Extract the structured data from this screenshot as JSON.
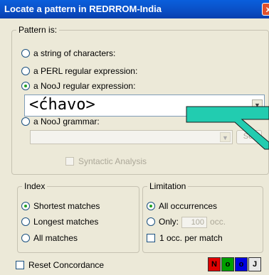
{
  "window": {
    "title": "Locate a pattern in REDRROM-India",
    "close_glyph": "x"
  },
  "pattern": {
    "legend": "Pattern is:",
    "options": [
      {
        "label": "a string of characters:",
        "selected": false
      },
      {
        "label": "a PERL regular expression:",
        "selected": false
      },
      {
        "label": "a NooJ regular expression:",
        "selected": true
      },
      {
        "label": "a NooJ grammar:",
        "selected": false
      }
    ],
    "regex_value": "<ćhavo>",
    "set_button": "Set",
    "syntactic_analysis": "Syntactic Analysis",
    "combo_arrow": "▼"
  },
  "index": {
    "legend": "Index",
    "options": [
      {
        "label": "Shortest matches",
        "selected": true
      },
      {
        "label": "Longest matches",
        "selected": false
      },
      {
        "label": "All matches",
        "selected": false
      }
    ]
  },
  "limitation": {
    "legend": "Limitation",
    "all_occurrences": "All occurrences",
    "only_label": "Only:",
    "only_value": "100",
    "occ_label": "occ.",
    "per_match": "1 occ. per match"
  },
  "footer": {
    "reset_concordance": "Reset Concordance",
    "color_buttons": [
      {
        "label": "N",
        "bg": "#e00000",
        "fg": "#000000"
      },
      {
        "label": "o",
        "bg": "#00a000",
        "fg": "#000000"
      },
      {
        "label": "o",
        "bg": "#0000e0",
        "fg": "#000000"
      },
      {
        "label": "J",
        "bg": "#e8e8e8",
        "fg": "#000000"
      }
    ]
  },
  "annotation_arrow": {
    "color": "#22ccb0"
  }
}
